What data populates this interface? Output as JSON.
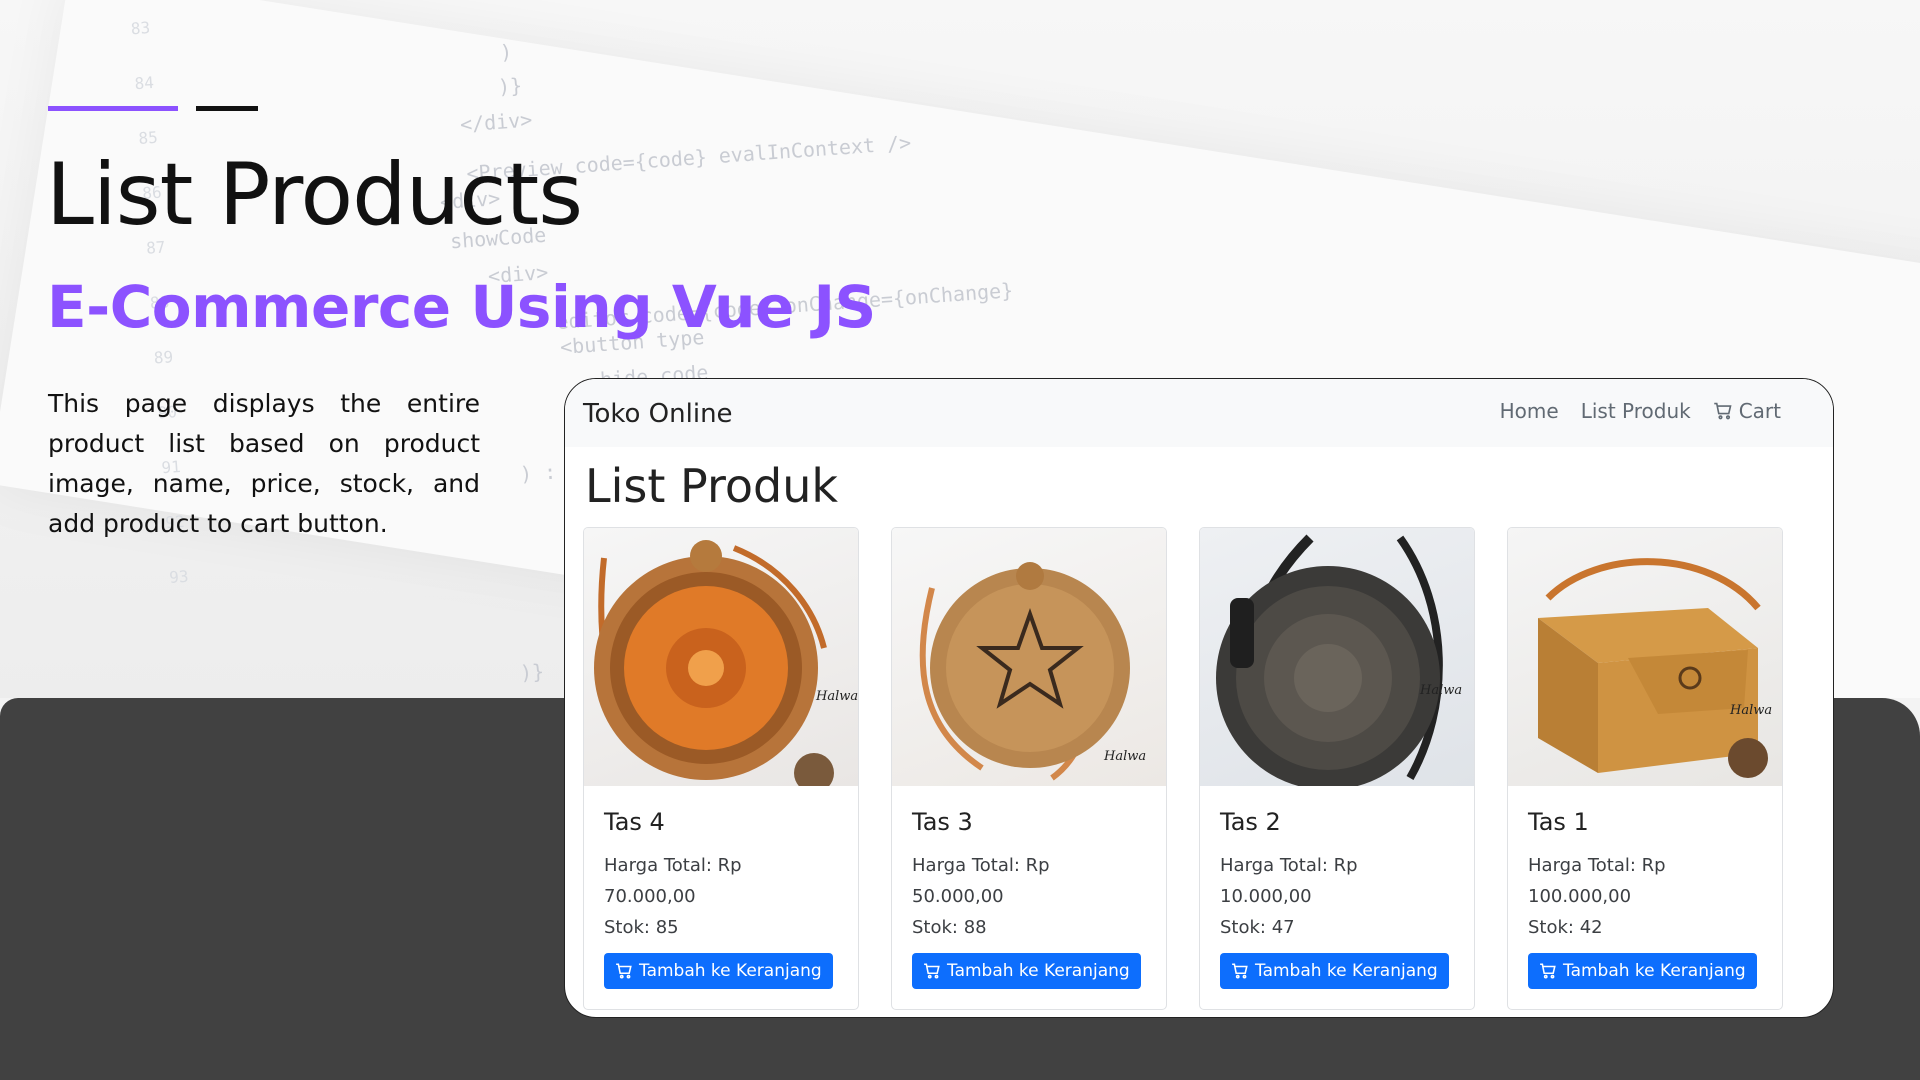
{
  "slide": {
    "title": "List Products",
    "subtitle": "E-Commerce Using Vue JS",
    "description": "This page displays the entire product list based on product image, name, price, stock, and add product to cart button.",
    "accent_color": "#8c52ff"
  },
  "app": {
    "brand": "Toko Online",
    "nav": {
      "home": "Home",
      "list_produk": "List Produk",
      "cart": "Cart"
    },
    "page_heading": "List Produk",
    "add_to_cart_label": "Tambah ke Keranjang",
    "button_color": "#0d6efd",
    "products": [
      {
        "name": "Tas 4",
        "price_label": "Harga Total: Rp 70.000,00",
        "stock_label": "Stok: 85"
      },
      {
        "name": "Tas 3",
        "price_label": "Harga Total: Rp 50.000,00",
        "stock_label": "Stok: 88"
      },
      {
        "name": "Tas 2",
        "price_label": "Harga Total: Rp 10.000,00",
        "stock_label": "Stok: 47"
      },
      {
        "name": "Tas 1",
        "price_label": "Harga Total: Rp 100.000,00",
        "stock_label": "Stok: 42"
      }
    ]
  }
}
